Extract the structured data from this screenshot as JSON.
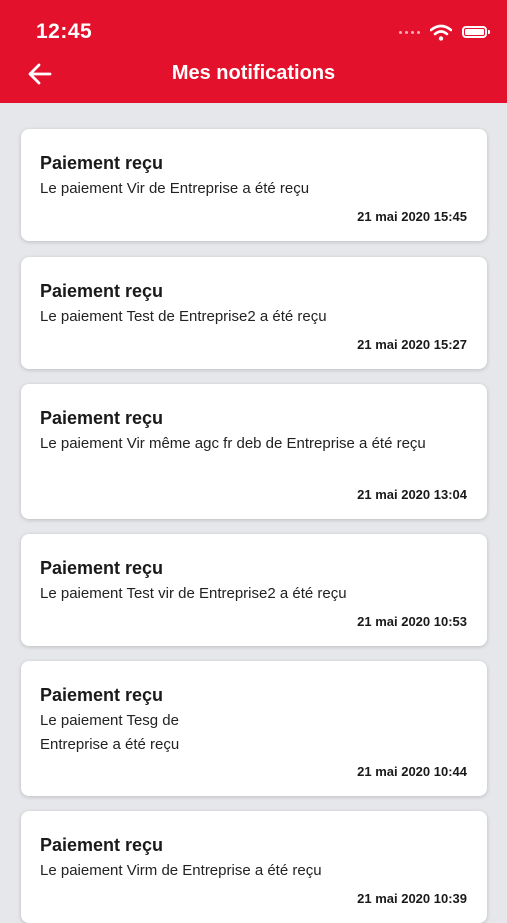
{
  "status_bar": {
    "time": "12:45",
    "icons": [
      "signal-dots-icon",
      "wifi-icon",
      "battery-icon"
    ]
  },
  "header": {
    "title": "Mes notifications",
    "back_icon": "arrow-left-icon",
    "background_color": "#e3112c"
  },
  "notifications": [
    {
      "title": "Paiement reçu",
      "message": "Le  paiement Vir de Entreprise a été reçu",
      "date": "21 mai 2020 15:45"
    },
    {
      "title": "Paiement reçu",
      "message": "Le  paiement Test  de Entreprise2 a été reçu",
      "date": "21 mai 2020 15:27"
    },
    {
      "title": "Paiement reçu",
      "message": "Le  paiement Vir même agc fr deb de Entreprise a été reçu",
      "date": "21 mai 2020 13:04"
    },
    {
      "title": "Paiement reçu",
      "message": "Le  paiement Test vir de Entreprise2 a été reçu",
      "date": "21 mai 2020 10:53"
    },
    {
      "title": "Paiement reçu",
      "message": "Le  paiement Tesg de Entreprise a été reçu",
      "date": "21 mai 2020 10:44"
    },
    {
      "title": "Paiement reçu",
      "message": "Le  paiement Virm  de Entreprise a été reçu",
      "date": "21 mai 2020 10:39"
    }
  ]
}
